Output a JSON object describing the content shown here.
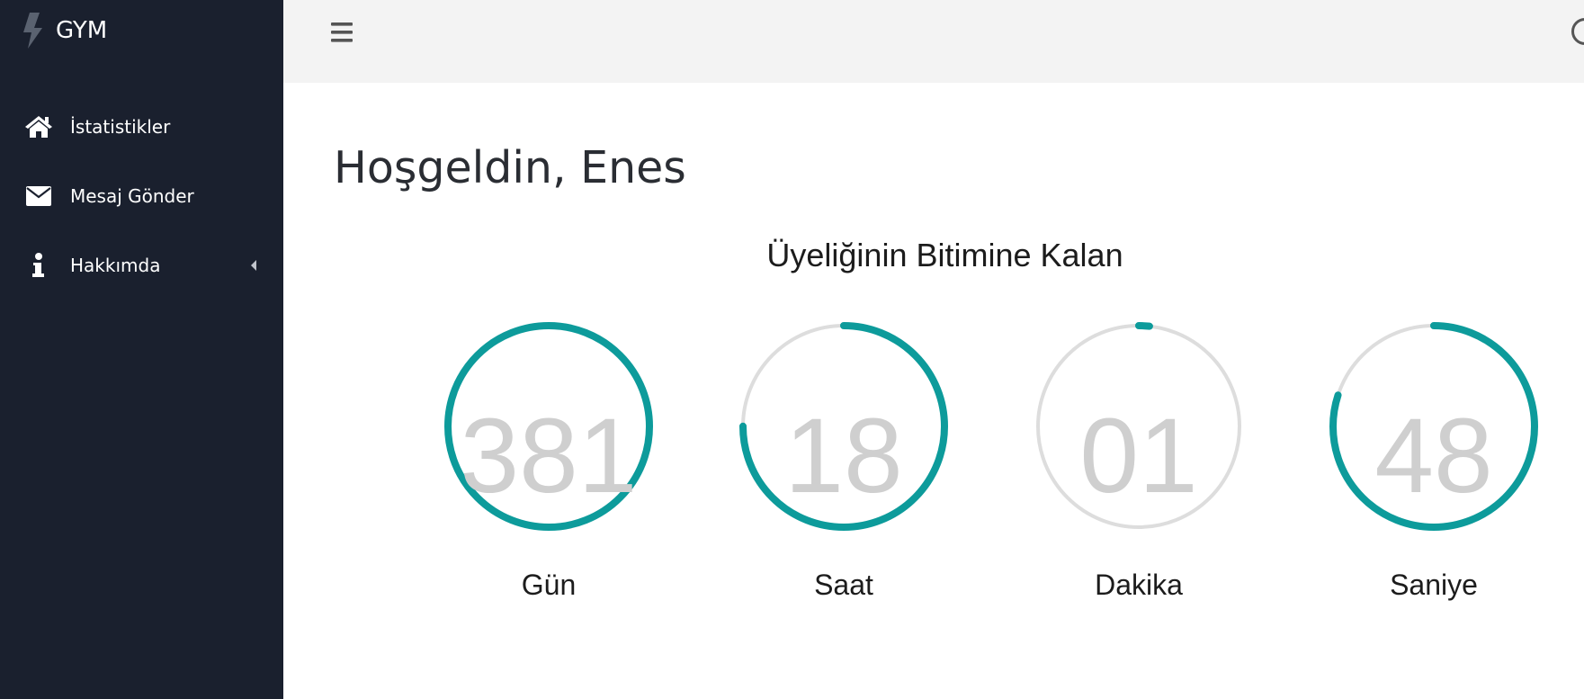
{
  "app": {
    "brand": "GYM"
  },
  "sidebar": {
    "items": [
      {
        "label": "İstatistikler",
        "icon": "home-icon"
      },
      {
        "label": "Mesaj Gönder",
        "icon": "envelope-icon"
      },
      {
        "label": "Hakkımda",
        "icon": "info-icon",
        "has_submenu": true
      }
    ]
  },
  "main": {
    "welcome": "Hoşgeldin, Enes",
    "countdown_title": "Üyeliğinin Bitimine Kalan",
    "timers": [
      {
        "value": "381",
        "label": "Gün",
        "fraction": 1.0
      },
      {
        "value": "18",
        "label": "Saat",
        "fraction": 0.75
      },
      {
        "value": "01",
        "label": "Dakika",
        "fraction": 0.017
      },
      {
        "value": "48",
        "label": "Saniye",
        "fraction": 0.8
      }
    ]
  },
  "colors": {
    "sidebar_bg": "#1a202e",
    "accent": "#0d9b9b",
    "ring_track": "#dddddd",
    "timer_text": "#cfcfcf"
  }
}
